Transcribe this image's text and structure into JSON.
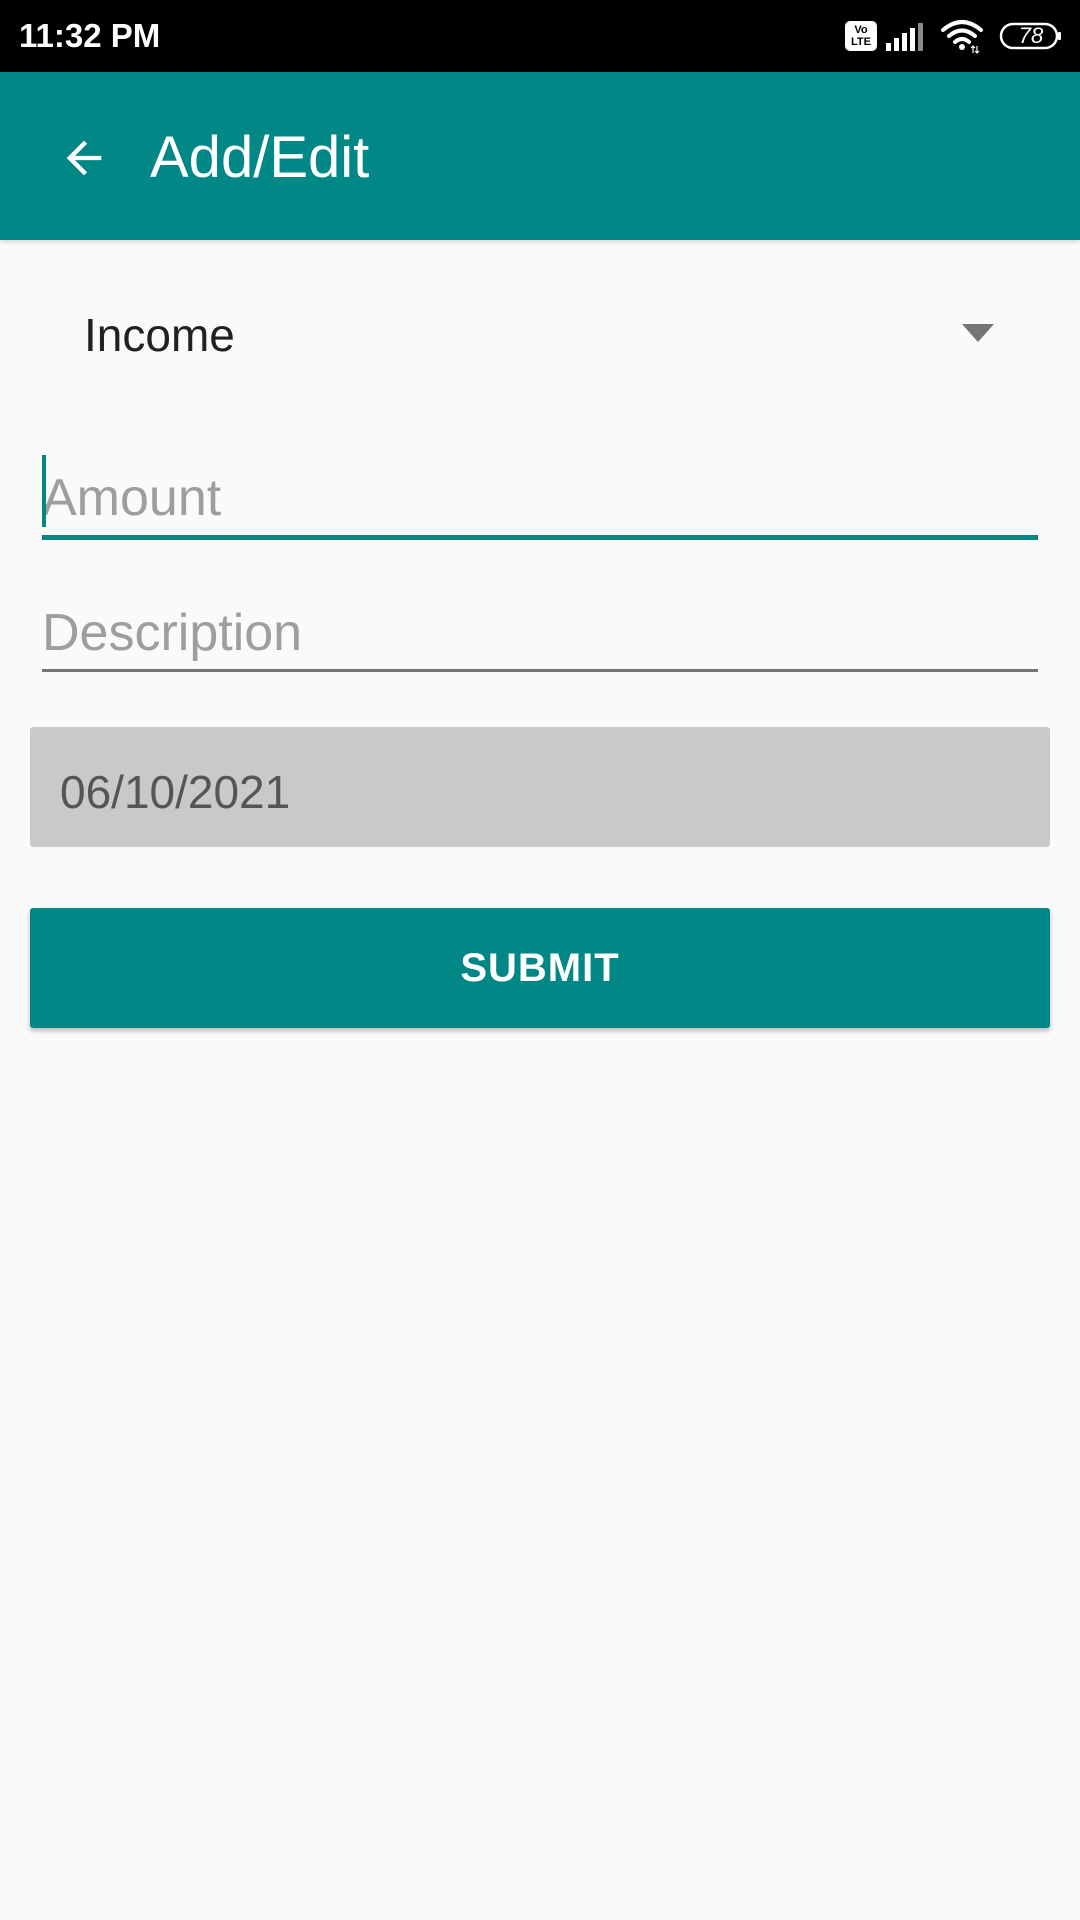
{
  "status_bar": {
    "time": "11:32 PM",
    "volte_label_top": "Vo",
    "volte_label_bottom": "LTE",
    "battery": "78",
    "icons": [
      "volte-icon",
      "signal-icon",
      "wifi-icon",
      "battery-icon"
    ]
  },
  "app_bar": {
    "title": "Add/Edit",
    "back_icon": "arrow-left-icon",
    "background": "#018786"
  },
  "form": {
    "type_selected": "Income",
    "type_dropdown_icon": "triangle-down-icon",
    "amount": {
      "value": "",
      "placeholder": "Amount"
    },
    "description": {
      "value": "",
      "placeholder": "Description"
    },
    "date": "06/10/2021",
    "submit_label": "SUBMIT"
  },
  "colors": {
    "accent": "#018786",
    "date_button_bg": "#cac8c9",
    "background": "#fafafa"
  }
}
